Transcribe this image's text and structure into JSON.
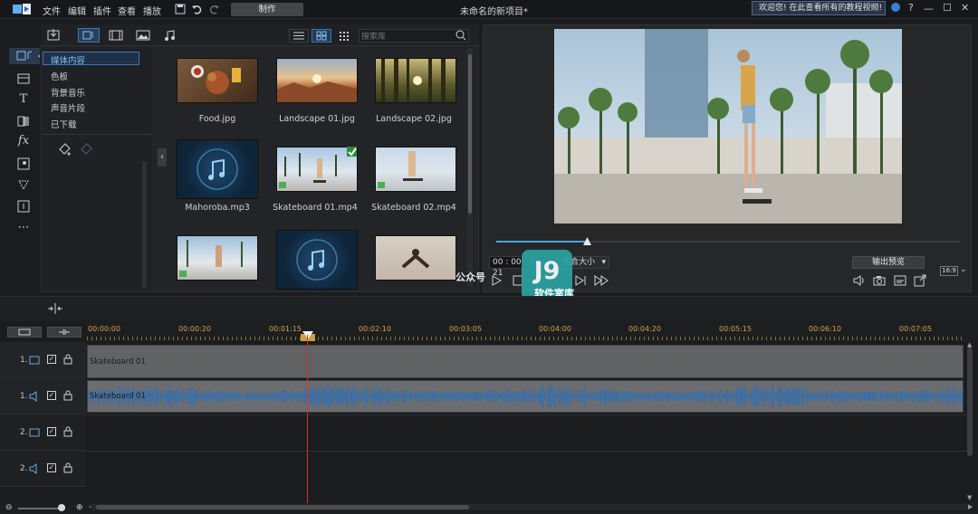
{
  "menu": [
    "文件",
    "编辑",
    "插件",
    "查看",
    "播放"
  ],
  "produce_label": "制作",
  "project_title": "未命名的新项目*",
  "welcome_text": "欢迎您! 在此查看所有的教程视频!",
  "window_buttons": {
    "help": "?",
    "minimize": "—",
    "maximize": "☐",
    "close": "✕"
  },
  "library": {
    "categories": [
      "媒体内容",
      "色板",
      "背景音乐",
      "声音片段",
      "已下载"
    ],
    "search_placeholder": "搜索库",
    "items": [
      {
        "label": "Food.jpg",
        "type": "image"
      },
      {
        "label": "Landscape 01.jpg",
        "type": "image"
      },
      {
        "label": "Landscape 02.jpg",
        "type": "image"
      },
      {
        "label": "Mahoroba.mp3",
        "type": "audio"
      },
      {
        "label": "Skateboard 01.mp4",
        "type": "video"
      },
      {
        "label": "Skateboard 02.mp4",
        "type": "video"
      }
    ]
  },
  "preview": {
    "timecode": "00 : 00 : 03 : 21",
    "fit_label": "适合大小",
    "output_preview_label": "输出预览",
    "aspect_ratio": "16:9",
    "scrub_progress": 0.2
  },
  "timeline": {
    "ruler_labels": [
      "00:00:00",
      "00:00:20",
      "00:01:15",
      "00:02:10",
      "00:03:05",
      "00:04:00",
      "00:04:20",
      "00:05:15",
      "00:06:10",
      "00:07:05"
    ],
    "tracks": [
      {
        "number": "1.",
        "kind": "video",
        "clip": "Skateboard 01"
      },
      {
        "number": "1.",
        "kind": "audio",
        "clip": "Skateboard 01"
      },
      {
        "number": "2.",
        "kind": "video",
        "clip": ""
      },
      {
        "number": "2.",
        "kind": "audio",
        "clip": ""
      }
    ]
  },
  "watermark": {
    "logo": "J9",
    "line1": "软件室库",
    "line2": "公众号"
  },
  "colors": {
    "accent": "#45a6e0",
    "playhead": "#d03333",
    "ruler_text": "#d6a24a",
    "waveform": "#2f6fb5"
  }
}
